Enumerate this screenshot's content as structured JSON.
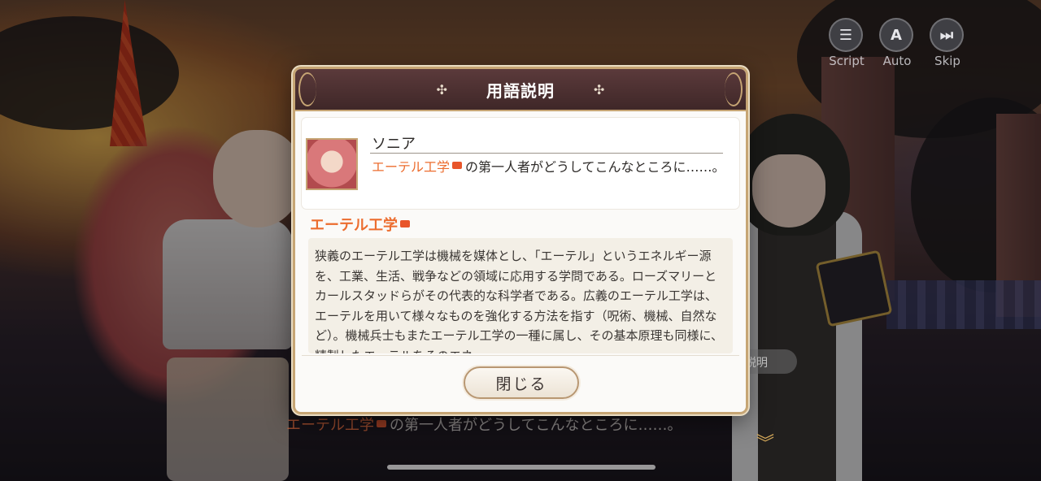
{
  "controls": [
    {
      "label": "Script",
      "glyph": "☰",
      "icon": "script-menu-icon"
    },
    {
      "label": "Auto",
      "glyph": "A",
      "icon": "auto-play-icon"
    },
    {
      "label": "Skip",
      "glyph": "⏭",
      "icon": "skip-icon"
    }
  ],
  "background": {
    "dialogue_term": "エーテル工学",
    "dialogue_rest": "の第一人者がどうしてこんなところに……。",
    "chip_label": "説明"
  },
  "modal": {
    "title": "用語説明",
    "speaker": {
      "name": "ソニア",
      "line_term": "エーテル工学",
      "line_rest": "の第一人者がどうしてこんなところに……。"
    },
    "term_title": "エーテル工学",
    "description": "狭義のエーテル工学は機械を媒体とし、「エーテル」というエネルギー源を、工業、生活、戦争などの領域に応用する学問である。ローズマリーとカールスタッドらがその代表的な科学者である。広義のエーテル工学は、エーテルを用いて様々なものを強化する方法を指す（呪術、機械、自然など）。機械兵士もまたエーテル工学の一種に属し、その基本原理も同様に、精製したエーテルをそのエネ",
    "close_label": "閉じる"
  },
  "colors": {
    "term": "#ec6d2f",
    "header_bg": "#4a2f30",
    "frame_gold": "#c6a574"
  }
}
